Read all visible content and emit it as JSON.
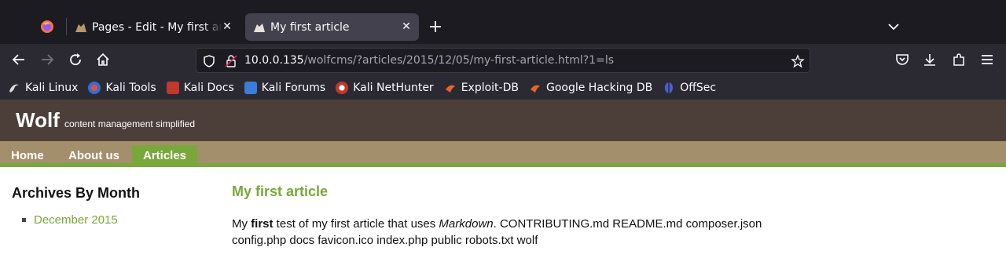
{
  "browser": {
    "tabs": [
      {
        "title": "Pages - Edit - My first article",
        "active": false
      },
      {
        "title": "My first article",
        "active": true
      }
    ],
    "url": {
      "host": "10.0.0.135",
      "path": "/wolfcms/?articles/2015/12/05/my-first-article.html?1=ls"
    },
    "bookmarks": [
      {
        "label": "Kali Linux",
        "icon": "kali-dragon-icon"
      },
      {
        "label": "Kali Tools",
        "icon": "kali-tools-icon"
      },
      {
        "label": "Kali Docs",
        "icon": "kali-docs-icon"
      },
      {
        "label": "Kali Forums",
        "icon": "kali-forums-icon"
      },
      {
        "label": "Kali NetHunter",
        "icon": "nethunter-icon"
      },
      {
        "label": "Exploit-DB",
        "icon": "exploit-db-icon"
      },
      {
        "label": "Google Hacking DB",
        "icon": "ghdb-icon"
      },
      {
        "label": "OffSec",
        "icon": "offsec-icon"
      }
    ]
  },
  "site": {
    "title": "Wolf",
    "tagline": "content management simplified",
    "nav": [
      {
        "label": "Home",
        "active": false
      },
      {
        "label": "About us",
        "active": false
      },
      {
        "label": "Articles",
        "active": true
      }
    ]
  },
  "sidebar": {
    "heading": "Archives By Month",
    "items": [
      {
        "label": "December 2015"
      }
    ]
  },
  "article": {
    "title": "My first article",
    "body": {
      "t1": "My ",
      "bold": "first",
      "t2": " test of my first article that uses ",
      "italic": "Markdown",
      "t3": ". CONTRIBUTING.md README.md composer.json config.php docs favicon.ico index.php public robots.txt wolf"
    }
  },
  "colors": {
    "header_bg": "#4c3f3a",
    "nav_bg": "#a48f6d",
    "accent_green": "#78a83a"
  }
}
